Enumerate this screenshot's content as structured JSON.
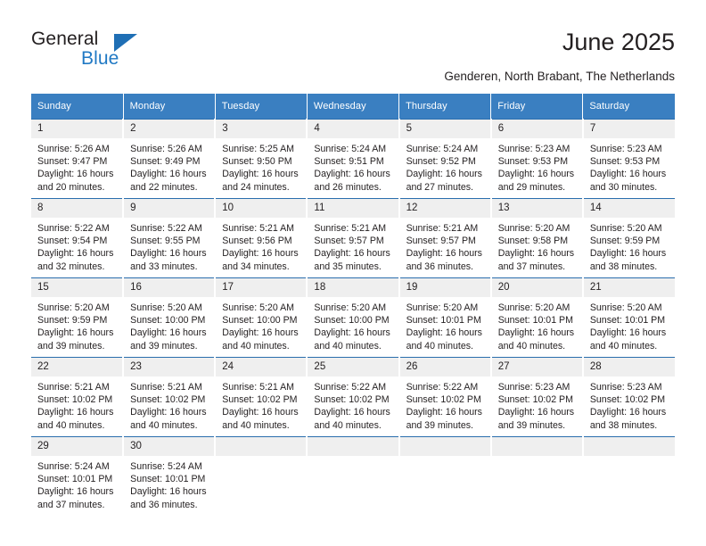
{
  "logo": {
    "word_one": "General",
    "word_two": "Blue",
    "triangle_color": "#1f6fb5",
    "blue_text_color": "#2079c4"
  },
  "header": {
    "title": "June 2025",
    "subtitle": "Genderen, North Brabant, The Netherlands"
  },
  "theme": {
    "header_bar": "#3a7fc1",
    "row_divider": "#2a6ead",
    "daynum_bg": "#efefef",
    "text": "#231f20"
  },
  "calendar": {
    "weekday_headers": [
      "Sunday",
      "Monday",
      "Tuesday",
      "Wednesday",
      "Thursday",
      "Friday",
      "Saturday"
    ],
    "weeks": [
      [
        {
          "day": "1",
          "sunrise": "Sunrise: 5:26 AM",
          "sunset": "Sunset: 9:47 PM",
          "daylight": "Daylight: 16 hours and 20 minutes."
        },
        {
          "day": "2",
          "sunrise": "Sunrise: 5:26 AM",
          "sunset": "Sunset: 9:49 PM",
          "daylight": "Daylight: 16 hours and 22 minutes."
        },
        {
          "day": "3",
          "sunrise": "Sunrise: 5:25 AM",
          "sunset": "Sunset: 9:50 PM",
          "daylight": "Daylight: 16 hours and 24 minutes."
        },
        {
          "day": "4",
          "sunrise": "Sunrise: 5:24 AM",
          "sunset": "Sunset: 9:51 PM",
          "daylight": "Daylight: 16 hours and 26 minutes."
        },
        {
          "day": "5",
          "sunrise": "Sunrise: 5:24 AM",
          "sunset": "Sunset: 9:52 PM",
          "daylight": "Daylight: 16 hours and 27 minutes."
        },
        {
          "day": "6",
          "sunrise": "Sunrise: 5:23 AM",
          "sunset": "Sunset: 9:53 PM",
          "daylight": "Daylight: 16 hours and 29 minutes."
        },
        {
          "day": "7",
          "sunrise": "Sunrise: 5:23 AM",
          "sunset": "Sunset: 9:53 PM",
          "daylight": "Daylight: 16 hours and 30 minutes."
        }
      ],
      [
        {
          "day": "8",
          "sunrise": "Sunrise: 5:22 AM",
          "sunset": "Sunset: 9:54 PM",
          "daylight": "Daylight: 16 hours and 32 minutes."
        },
        {
          "day": "9",
          "sunrise": "Sunrise: 5:22 AM",
          "sunset": "Sunset: 9:55 PM",
          "daylight": "Daylight: 16 hours and 33 minutes."
        },
        {
          "day": "10",
          "sunrise": "Sunrise: 5:21 AM",
          "sunset": "Sunset: 9:56 PM",
          "daylight": "Daylight: 16 hours and 34 minutes."
        },
        {
          "day": "11",
          "sunrise": "Sunrise: 5:21 AM",
          "sunset": "Sunset: 9:57 PM",
          "daylight": "Daylight: 16 hours and 35 minutes."
        },
        {
          "day": "12",
          "sunrise": "Sunrise: 5:21 AM",
          "sunset": "Sunset: 9:57 PM",
          "daylight": "Daylight: 16 hours and 36 minutes."
        },
        {
          "day": "13",
          "sunrise": "Sunrise: 5:20 AM",
          "sunset": "Sunset: 9:58 PM",
          "daylight": "Daylight: 16 hours and 37 minutes."
        },
        {
          "day": "14",
          "sunrise": "Sunrise: 5:20 AM",
          "sunset": "Sunset: 9:59 PM",
          "daylight": "Daylight: 16 hours and 38 minutes."
        }
      ],
      [
        {
          "day": "15",
          "sunrise": "Sunrise: 5:20 AM",
          "sunset": "Sunset: 9:59 PM",
          "daylight": "Daylight: 16 hours and 39 minutes."
        },
        {
          "day": "16",
          "sunrise": "Sunrise: 5:20 AM",
          "sunset": "Sunset: 10:00 PM",
          "daylight": "Daylight: 16 hours and 39 minutes."
        },
        {
          "day": "17",
          "sunrise": "Sunrise: 5:20 AM",
          "sunset": "Sunset: 10:00 PM",
          "daylight": "Daylight: 16 hours and 40 minutes."
        },
        {
          "day": "18",
          "sunrise": "Sunrise: 5:20 AM",
          "sunset": "Sunset: 10:00 PM",
          "daylight": "Daylight: 16 hours and 40 minutes."
        },
        {
          "day": "19",
          "sunrise": "Sunrise: 5:20 AM",
          "sunset": "Sunset: 10:01 PM",
          "daylight": "Daylight: 16 hours and 40 minutes."
        },
        {
          "day": "20",
          "sunrise": "Sunrise: 5:20 AM",
          "sunset": "Sunset: 10:01 PM",
          "daylight": "Daylight: 16 hours and 40 minutes."
        },
        {
          "day": "21",
          "sunrise": "Sunrise: 5:20 AM",
          "sunset": "Sunset: 10:01 PM",
          "daylight": "Daylight: 16 hours and 40 minutes."
        }
      ],
      [
        {
          "day": "22",
          "sunrise": "Sunrise: 5:21 AM",
          "sunset": "Sunset: 10:02 PM",
          "daylight": "Daylight: 16 hours and 40 minutes."
        },
        {
          "day": "23",
          "sunrise": "Sunrise: 5:21 AM",
          "sunset": "Sunset: 10:02 PM",
          "daylight": "Daylight: 16 hours and 40 minutes."
        },
        {
          "day": "24",
          "sunrise": "Sunrise: 5:21 AM",
          "sunset": "Sunset: 10:02 PM",
          "daylight": "Daylight: 16 hours and 40 minutes."
        },
        {
          "day": "25",
          "sunrise": "Sunrise: 5:22 AM",
          "sunset": "Sunset: 10:02 PM",
          "daylight": "Daylight: 16 hours and 40 minutes."
        },
        {
          "day": "26",
          "sunrise": "Sunrise: 5:22 AM",
          "sunset": "Sunset: 10:02 PM",
          "daylight": "Daylight: 16 hours and 39 minutes."
        },
        {
          "day": "27",
          "sunrise": "Sunrise: 5:23 AM",
          "sunset": "Sunset: 10:02 PM",
          "daylight": "Daylight: 16 hours and 39 minutes."
        },
        {
          "day": "28",
          "sunrise": "Sunrise: 5:23 AM",
          "sunset": "Sunset: 10:02 PM",
          "daylight": "Daylight: 16 hours and 38 minutes."
        }
      ],
      [
        {
          "day": "29",
          "sunrise": "Sunrise: 5:24 AM",
          "sunset": "Sunset: 10:01 PM",
          "daylight": "Daylight: 16 hours and 37 minutes."
        },
        {
          "day": "30",
          "sunrise": "Sunrise: 5:24 AM",
          "sunset": "Sunset: 10:01 PM",
          "daylight": "Daylight: 16 hours and 36 minutes."
        },
        {
          "day": "",
          "sunrise": "",
          "sunset": "",
          "daylight": ""
        },
        {
          "day": "",
          "sunrise": "",
          "sunset": "",
          "daylight": ""
        },
        {
          "day": "",
          "sunrise": "",
          "sunset": "",
          "daylight": ""
        },
        {
          "day": "",
          "sunrise": "",
          "sunset": "",
          "daylight": ""
        },
        {
          "day": "",
          "sunrise": "",
          "sunset": "",
          "daylight": ""
        }
      ]
    ]
  }
}
